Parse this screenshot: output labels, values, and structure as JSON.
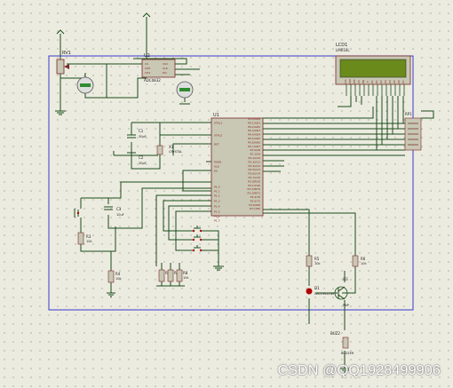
{
  "components": {
    "rv1": {
      "ref": "RV1"
    },
    "u2": {
      "ref": "U2",
      "part": "ADC0832"
    },
    "lcd": {
      "ref": "LCD1",
      "part": "LM016L",
      "display": ""
    },
    "u1": {
      "ref": "U1"
    },
    "c1": {
      "ref": "C1",
      "value": "30pF"
    },
    "c2": {
      "ref": "C2",
      "value": "30pF"
    },
    "x1": {
      "ref": "X1",
      "value": "CRYSTAL"
    },
    "c3": {
      "ref": "C3",
      "value": "10uF"
    },
    "r3": {
      "ref": "R3",
      "value": "10k"
    },
    "r1": {
      "ref": "R1",
      "value": "10k"
    },
    "r4": {
      "ref": "R4",
      "value": "10k"
    },
    "r5": {
      "ref": "R5",
      "value": "10k"
    },
    "r6": {
      "ref": "R6",
      "value": "10k"
    },
    "r7": {
      "ref": "R7",
      "value": "10k"
    },
    "r8": {
      "ref": "R8",
      "value": "10k"
    },
    "d1": {
      "ref": "D1",
      "part": "LED-YELLOW"
    },
    "q3": {
      "ref": "Q3",
      "part": "PNP"
    },
    "buzzer": {
      "ref": "BUZ2",
      "part": "BUZZER"
    },
    "rp1": {
      "ref": "RP1"
    }
  },
  "u1_pins_left": [
    "XTAL1",
    "XTAL2",
    "RST",
    "PSEN",
    "ALE",
    "EA",
    "P1.0",
    "P1.1",
    "P1.2",
    "P1.3",
    "P1.4",
    "P1.5",
    "P1.6",
    "P1.7"
  ],
  "u1_pins_right": [
    "P0.0/AD0",
    "P0.1/AD1",
    "P0.2/AD2",
    "P0.3/AD3",
    "P0.4/AD4",
    "P0.5/AD5",
    "P0.6/AD6",
    "P0.7/AD7",
    "P2.0/A8",
    "P2.1/A9",
    "P2.2/A10",
    "P2.3/A11",
    "P2.4/A12",
    "P2.5/A13",
    "P2.6/A14",
    "P2.7/A15",
    "P3.0/RXD",
    "P3.1/TXD",
    "P3.2/INT0",
    "P3.3/INT1",
    "P3.4/T0",
    "P3.5/T1",
    "P3.6/WR",
    "P3.7/RD"
  ],
  "lcd_pins": [
    "VSS",
    "VDD",
    "VEE",
    "RS",
    "RW",
    "E",
    "D0",
    "D1",
    "D2",
    "D3",
    "D4",
    "D5",
    "D6",
    "D7"
  ],
  "u2_pins": [
    "CS",
    "CH0",
    "CH1",
    "GND",
    "VCC",
    "CLK",
    "DO",
    "DI"
  ],
  "watermark": "CSDN @QQ1928499906",
  "colors": {
    "wire": "#1a4d1a",
    "body_fill": "#c8c8b4",
    "body_stroke": "#7a2a2a",
    "frame": "#3a3acc",
    "lcd_screen": "#6b8a1c",
    "led": "#b00000",
    "gauge": "#2e8b2e",
    "pin_text": "#8a2020"
  },
  "icons": [
    "potentiometer-icon",
    "voltmeter-gauge-icon",
    "crystal-icon",
    "capacitor-icon",
    "resistor-icon",
    "push-button-icon",
    "led-icon",
    "pnp-transistor-icon",
    "buzzer-icon",
    "ground-icon",
    "power-rail-icon",
    "resistor-pack-icon"
  ]
}
